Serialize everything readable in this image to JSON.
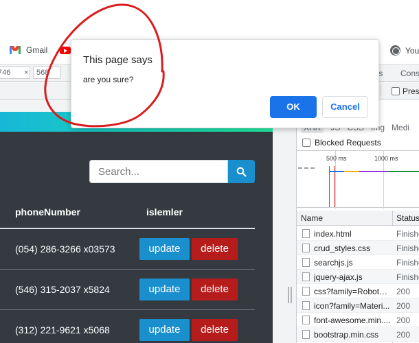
{
  "bookmarks": {
    "gmail_label": "Gmail",
    "right_label": "You"
  },
  "devtools": {
    "width_value": "746",
    "height_value": "568",
    "dimension_separator": "×",
    "tab_sources_partial": "ts",
    "tab_console_partial": "Cons",
    "preserve_partial": "Pres",
    "filter_types_partial": [
      "XHR",
      "JS",
      "CSS",
      "Img",
      "Medi"
    ],
    "blocked_requests_label": "Blocked Requests",
    "timeline_labels": [
      "500 ms",
      "1000 ms"
    ],
    "columns": {
      "name": "Name",
      "status": "Status"
    },
    "requests": [
      {
        "name": "index.html",
        "status": "Finishe"
      },
      {
        "name": "crud_styles.css",
        "status": "Finishe"
      },
      {
        "name": "searchjs.js",
        "status": "Finishe"
      },
      {
        "name": "jquery-ajax.js",
        "status": "Finishe"
      },
      {
        "name": "css?family=Roboto|...",
        "status": "200"
      },
      {
        "name": "icon?family=Materi...",
        "status": "200"
      },
      {
        "name": "font-awesome.min....",
        "status": "200"
      },
      {
        "name": "bootstrap.min.css",
        "status": "200"
      }
    ]
  },
  "page": {
    "search_placeholder": "Search...",
    "table": {
      "headers": {
        "phone": "phoneNumber",
        "actions": "islemler"
      },
      "rows": [
        {
          "phone": "(054) 286-3266 x03573",
          "update": "update",
          "delete": "delete"
        },
        {
          "phone": "(546) 315-2037 x5824",
          "update": "update",
          "delete": "delete"
        },
        {
          "phone": "(312) 221-9621 x5068",
          "update": "update",
          "delete": "delete"
        }
      ]
    }
  },
  "dialog": {
    "title": "This page says",
    "message": "are you sure?",
    "ok_label": "OK",
    "cancel_label": "Cancel"
  },
  "colors": {
    "ok_blue": "#1a73e8",
    "update_blue": "#1a8fce",
    "delete_red": "#b71c1c",
    "page_dark": "#343a40",
    "annotation_red": "#d91c1c"
  }
}
